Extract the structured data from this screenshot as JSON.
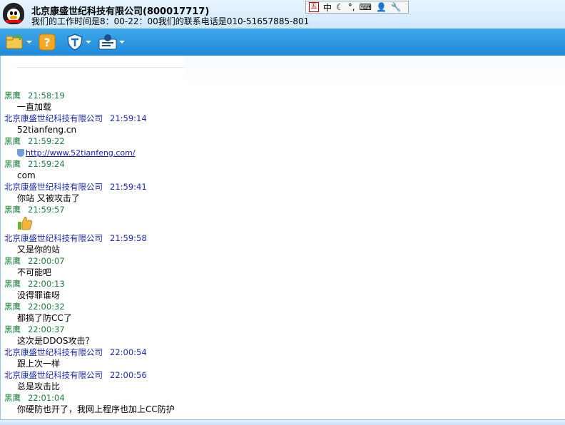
{
  "window": {
    "title": "北京康盛世纪科技有限公司(800017717)",
    "subtitle": "我们的工作时间是8：00-22：00我们的联系电话是010-51657885-801"
  },
  "ime": {
    "mode_glyph": "五",
    "lang": "中"
  },
  "toolbar": {
    "buttons": [
      {
        "name": "file-transfer",
        "icon": "folder-icon"
      },
      {
        "name": "help",
        "icon": "question-icon"
      },
      {
        "name": "security",
        "icon": "shield-icon"
      },
      {
        "name": "contact-info",
        "icon": "id-card-icon"
      }
    ]
  },
  "messages": [
    {
      "sender": "黑鹰",
      "time": "21:58:19",
      "type": "text",
      "text": "一直加载"
    },
    {
      "sender": "北京康盛世纪科技有限公司",
      "time": "21:59:14",
      "type": "text",
      "text": "52tianfeng.cn"
    },
    {
      "sender": "黑鹰",
      "time": "21:59:22",
      "type": "link",
      "text": "http://www.52tianfeng.com/"
    },
    {
      "sender": "黑鹰",
      "time": "21:59:24",
      "type": "text",
      "text": "com"
    },
    {
      "sender": "北京康盛世纪科技有限公司",
      "time": "21:59:41",
      "type": "text",
      "text": "你站 又被攻击了"
    },
    {
      "sender": "黑鹰",
      "time": "21:59:57",
      "type": "emoji",
      "text": "thumbs-up"
    },
    {
      "sender": "北京康盛世纪科技有限公司",
      "time": "21:59:58",
      "type": "text",
      "text": "又是你的站"
    },
    {
      "sender": "黑鹰",
      "time": "22:00:07",
      "type": "text",
      "text": "不可能吧"
    },
    {
      "sender": "黑鹰",
      "time": "22:00:13",
      "type": "text",
      "text": "没得罪谁呀"
    },
    {
      "sender": "黑鹰",
      "time": "22:00:32",
      "type": "text",
      "text": "都搞了防CC了"
    },
    {
      "sender": "黑鹰",
      "time": "22:00:37",
      "type": "text",
      "text": "这次是DDOS攻击？"
    },
    {
      "sender": "北京康盛世纪科技有限公司",
      "time": "22:00:54",
      "type": "text",
      "text": "跟上次一样"
    },
    {
      "sender": "北京康盛世纪科技有限公司",
      "time": "22:00:56",
      "type": "text",
      "text": "总是攻击比"
    },
    {
      "sender": "黑鹰",
      "time": "22:01:04",
      "type": "text",
      "text": "你硬防也开了，我网上程序也加上CC防护"
    }
  ],
  "colors": {
    "me": "#1a7f3a",
    "company": "#1b2bb0",
    "toolbar": "#2b97e0"
  }
}
